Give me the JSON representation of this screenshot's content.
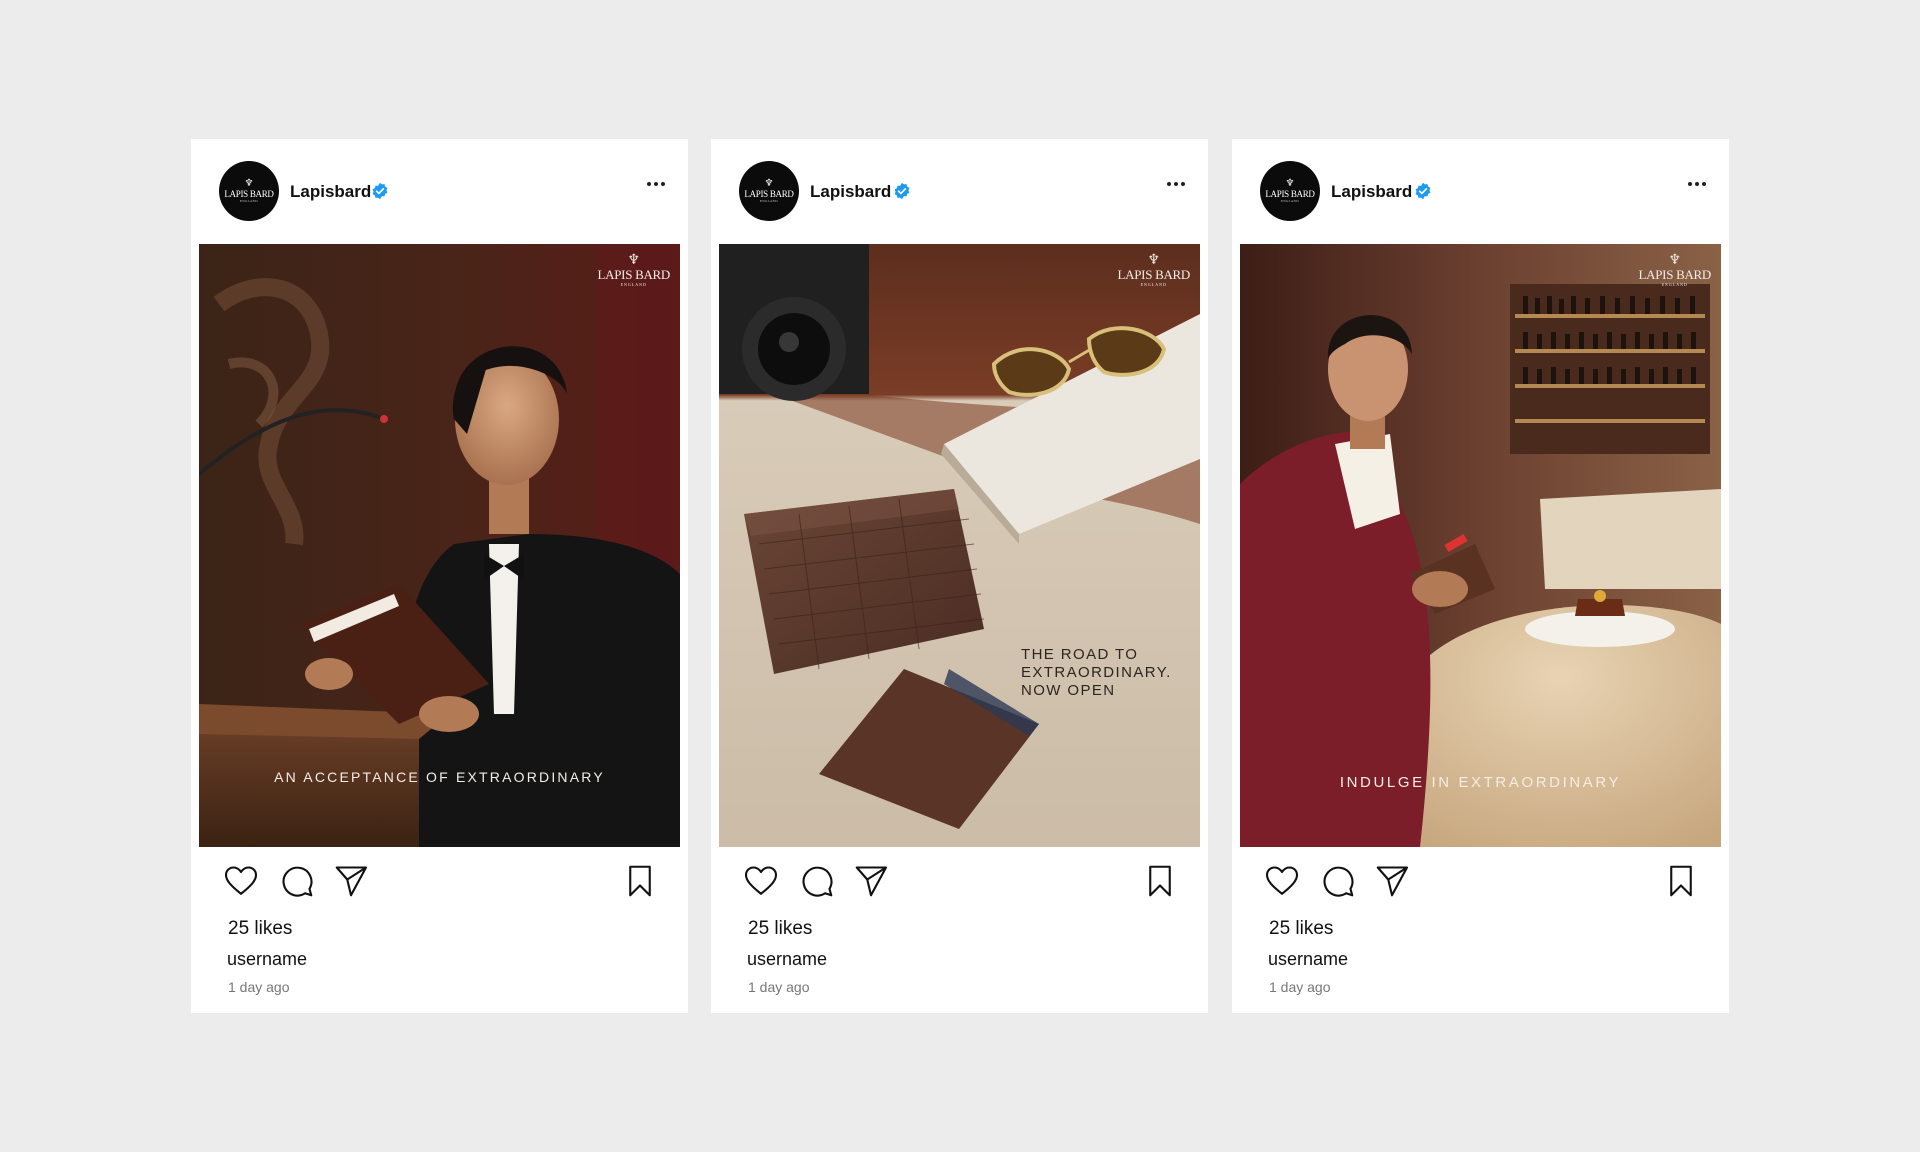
{
  "posts": [
    {
      "brand": "Lapisbard",
      "avatar_text": "LAPIS BARD",
      "avatar_sub": "ENGLAND",
      "logo_text": "LAPIS BARD",
      "logo_sub": "ENGLAND",
      "caption": "AN ACCEPTANCE OF EXTRAORDINARY",
      "likes": "25 likes",
      "username": "username",
      "time": "1 day ago"
    },
    {
      "brand": "Lapisbard",
      "avatar_text": "LAPIS BARD",
      "avatar_sub": "ENGLAND",
      "logo_text": "LAPIS BARD",
      "logo_sub": "ENGLAND",
      "caption_lines": [
        "THE ROAD TO",
        "EXTRAORDINARY.",
        "NOW OPEN"
      ],
      "likes": "25 likes",
      "username": "username",
      "time": "1 day ago"
    },
    {
      "brand": "Lapisbard",
      "avatar_text": "LAPIS BARD",
      "avatar_sub": "ENGLAND",
      "logo_text": "LAPIS BARD",
      "logo_sub": "ENGLAND",
      "caption": "INDULGE IN EXTRAORDINARY",
      "likes": "25 likes",
      "username": "username",
      "time": "1 day ago"
    }
  ],
  "icons": {
    "like": "heart-icon",
    "comment": "comment-icon",
    "share": "send-icon",
    "save": "bookmark-icon",
    "more": "more-options-icon",
    "verified": "verified-badge-icon"
  },
  "colors": {
    "background": "#ececec",
    "card": "#ffffff",
    "verified": "#1d9bf0"
  }
}
